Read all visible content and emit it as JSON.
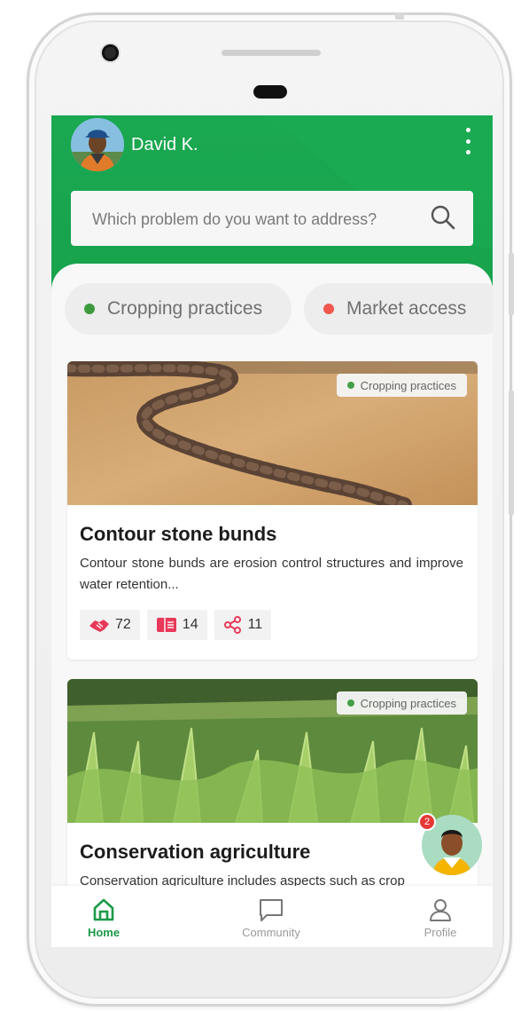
{
  "user": {
    "name": "David K."
  },
  "search": {
    "placeholder": "Which problem do you want to address?"
  },
  "categories": [
    {
      "label": "Cropping practices",
      "color": "#3d9b3d"
    },
    {
      "label": "Market access",
      "color": "#f0584e"
    }
  ],
  "cards": [
    {
      "tag": "Cropping practices",
      "title": "Contour stone bunds",
      "description": "Contour stone bunds are erosion control structures and improve water retention...",
      "stats": {
        "likes": "72",
        "reads": "14",
        "shares": "11"
      }
    },
    {
      "tag": "Cropping practices",
      "title": "Conservation agriculture",
      "description": "Conservation agriculture includes aspects such as crop"
    }
  ],
  "assistant": {
    "badge_count": "2"
  },
  "nav": [
    {
      "label": "Home",
      "active": true
    },
    {
      "label": "Community",
      "active": false
    },
    {
      "label": "Profile",
      "active": false
    }
  ],
  "colors": {
    "brand_green": "#17a24c",
    "accent_red": "#e8395a",
    "nav_active": "#1c9a48",
    "nav_inactive": "#9a9a9a"
  },
  "icons": {
    "menu": "kebab-menu-icon",
    "search": "search-icon",
    "likes": "handshake-icon",
    "reads": "book-icon",
    "shares": "share-icon",
    "home": "home-icon",
    "community": "chat-icon",
    "profile": "person-icon"
  }
}
